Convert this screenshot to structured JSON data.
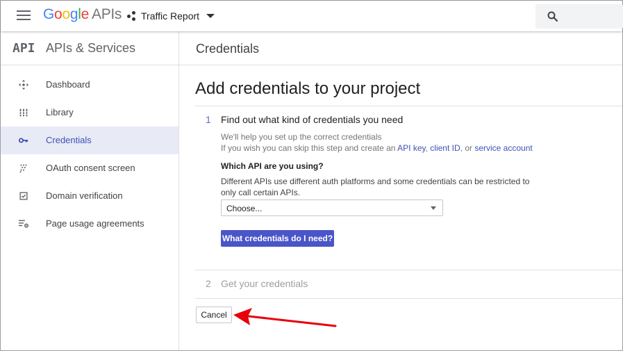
{
  "topbar": {
    "logo_google": [
      "G",
      "o",
      "o",
      "g",
      "l",
      "e"
    ],
    "logo_apis": "APIs",
    "project_name": "Traffic Report"
  },
  "sidebar": {
    "badge": "API",
    "title": "APIs & Services",
    "items": [
      {
        "label": "Dashboard",
        "icon": "dashboard-icon"
      },
      {
        "label": "Library",
        "icon": "library-icon"
      },
      {
        "label": "Credentials",
        "icon": "key-icon",
        "active": true
      },
      {
        "label": "OAuth consent screen",
        "icon": "oauth-icon"
      },
      {
        "label": "Domain verification",
        "icon": "checkbox-icon"
      },
      {
        "label": "Page usage agreements",
        "icon": "settings-list-icon"
      }
    ]
  },
  "main": {
    "header": "Credentials",
    "page_title": "Add credentials to your project",
    "step1": {
      "number": "1",
      "title": "Find out what kind of credentials you need",
      "help_line1": "We'll help you set up the correct credentials",
      "help_line2_prefix": "If you wish you can skip this step and create an ",
      "link_api_key": "API key",
      "sep1": ", ",
      "link_client_id": "client ID",
      "sep2": ", or ",
      "link_service_account": "service account",
      "question": "Which API are you using?",
      "description": "Different APIs use different auth platforms and some credentials can be restricted to only call certain APIs.",
      "select_value": "Choose...",
      "button_label": "What credentials do I need?"
    },
    "step2": {
      "number": "2",
      "title": "Get your credentials"
    },
    "cancel_label": "Cancel"
  },
  "colors": {
    "accent": "#3f51b5",
    "button": "#4a55c8",
    "active_bg": "#e8eaf6",
    "annotation_arrow": "#e8000b"
  }
}
